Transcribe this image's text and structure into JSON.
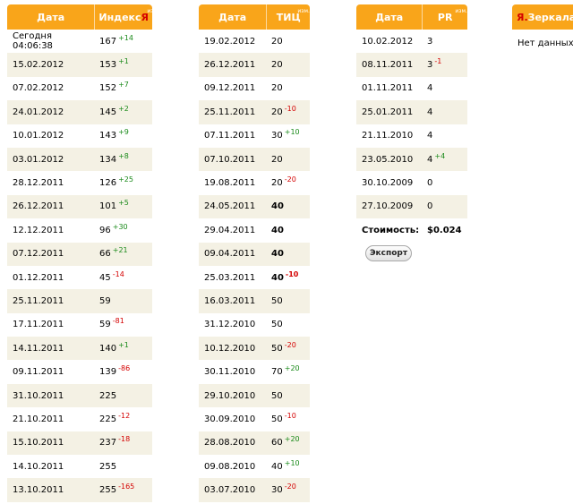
{
  "yandex_index": {
    "headers": {
      "date": "Дата",
      "value_prefix": "Индекс ",
      "value_ya": "Я",
      "change": "изм."
    },
    "rows": [
      {
        "date": "Сегодня 04:06:38",
        "value": "167",
        "delta": "+14",
        "dir": "up"
      },
      {
        "date": "15.02.2012",
        "value": "153",
        "delta": "+1",
        "dir": "up"
      },
      {
        "date": "07.02.2012",
        "value": "152",
        "delta": "+7",
        "dir": "up"
      },
      {
        "date": "24.01.2012",
        "value": "145",
        "delta": "+2",
        "dir": "up"
      },
      {
        "date": "10.01.2012",
        "value": "143",
        "delta": "+9",
        "dir": "up"
      },
      {
        "date": "03.01.2012",
        "value": "134",
        "delta": "+8",
        "dir": "up"
      },
      {
        "date": "28.12.2011",
        "value": "126",
        "delta": "+25",
        "dir": "up"
      },
      {
        "date": "26.12.2011",
        "value": "101",
        "delta": "+5",
        "dir": "up"
      },
      {
        "date": "12.12.2011",
        "value": "96",
        "delta": "+30",
        "dir": "up"
      },
      {
        "date": "07.12.2011",
        "value": "66",
        "delta": "+21",
        "dir": "up"
      },
      {
        "date": "01.12.2011",
        "value": "45",
        "delta": "-14",
        "dir": "down"
      },
      {
        "date": "25.11.2011",
        "value": "59",
        "delta": "",
        "dir": ""
      },
      {
        "date": "17.11.2011",
        "value": "59",
        "delta": "-81",
        "dir": "down"
      },
      {
        "date": "14.11.2011",
        "value": "140",
        "delta": "+1",
        "dir": "up"
      },
      {
        "date": "09.11.2011",
        "value": "139",
        "delta": "-86",
        "dir": "down"
      },
      {
        "date": "31.10.2011",
        "value": "225",
        "delta": "",
        "dir": ""
      },
      {
        "date": "21.10.2011",
        "value": "225",
        "delta": "-12",
        "dir": "down"
      },
      {
        "date": "15.10.2011",
        "value": "237",
        "delta": "-18",
        "dir": "down"
      },
      {
        "date": "14.10.2011",
        "value": "255",
        "delta": "",
        "dir": ""
      },
      {
        "date": "13.10.2011",
        "value": "255",
        "delta": "-165",
        "dir": "down"
      }
    ]
  },
  "tic": {
    "headers": {
      "date": "Дата",
      "value": "ТИЦ",
      "change": "изм."
    },
    "rows": [
      {
        "date": "19.02.2012",
        "value": "20",
        "delta": "",
        "dir": "",
        "bold": false
      },
      {
        "date": "26.12.2011",
        "value": "20",
        "delta": "",
        "dir": "",
        "bold": false
      },
      {
        "date": "09.12.2011",
        "value": "20",
        "delta": "",
        "dir": "",
        "bold": false
      },
      {
        "date": "25.11.2011",
        "value": "20",
        "delta": "-10",
        "dir": "down",
        "bold": false
      },
      {
        "date": "07.11.2011",
        "value": "30",
        "delta": "+10",
        "dir": "up",
        "bold": false
      },
      {
        "date": "07.10.2011",
        "value": "20",
        "delta": "",
        "dir": "",
        "bold": false
      },
      {
        "date": "19.08.2011",
        "value": "20",
        "delta": "-20",
        "dir": "down",
        "bold": false
      },
      {
        "date": "24.05.2011",
        "value": "40",
        "delta": "",
        "dir": "",
        "bold": true
      },
      {
        "date": "29.04.2011",
        "value": "40",
        "delta": "",
        "dir": "",
        "bold": true
      },
      {
        "date": "09.04.2011",
        "value": "40",
        "delta": "",
        "dir": "",
        "bold": true
      },
      {
        "date": "25.03.2011",
        "value": "40",
        "delta": "-10",
        "dir": "down",
        "bold": true
      },
      {
        "date": "16.03.2011",
        "value": "50",
        "delta": "",
        "dir": "",
        "bold": false
      },
      {
        "date": "31.12.2010",
        "value": "50",
        "delta": "",
        "dir": "",
        "bold": false
      },
      {
        "date": "10.12.2010",
        "value": "50",
        "delta": "-20",
        "dir": "down",
        "bold": false
      },
      {
        "date": "30.11.2010",
        "value": "70",
        "delta": "+20",
        "dir": "up",
        "bold": false
      },
      {
        "date": "29.10.2010",
        "value": "50",
        "delta": "",
        "dir": "",
        "bold": false
      },
      {
        "date": "30.09.2010",
        "value": "50",
        "delta": "-10",
        "dir": "down",
        "bold": false
      },
      {
        "date": "28.08.2010",
        "value": "60",
        "delta": "+20",
        "dir": "up",
        "bold": false
      },
      {
        "date": "09.08.2010",
        "value": "40",
        "delta": "+10",
        "dir": "up",
        "bold": false
      },
      {
        "date": "03.07.2010",
        "value": "30",
        "delta": "-20",
        "dir": "down",
        "bold": false
      }
    ]
  },
  "pagerank": {
    "headers": {
      "date": "Дата",
      "value": "PR",
      "change": "изм."
    },
    "rows": [
      {
        "date": "10.02.2012",
        "value": "3",
        "delta": "",
        "dir": ""
      },
      {
        "date": "08.11.2011",
        "value": "3",
        "delta": "-1",
        "dir": "down"
      },
      {
        "date": "01.11.2011",
        "value": "4",
        "delta": "",
        "dir": ""
      },
      {
        "date": "25.01.2011",
        "value": "4",
        "delta": "",
        "dir": ""
      },
      {
        "date": "21.11.2010",
        "value": "4",
        "delta": "",
        "dir": ""
      },
      {
        "date": "23.05.2010",
        "value": "4",
        "delta": "+4",
        "dir": "up"
      },
      {
        "date": "30.10.2009",
        "value": "0",
        "delta": "",
        "dir": ""
      },
      {
        "date": "27.10.2009",
        "value": "0",
        "delta": "",
        "dir": ""
      }
    ],
    "cost_label": "Стоимость:",
    "cost_value": "$0.024",
    "export_label": "Экспорт"
  },
  "mirrors": {
    "header_ya": "Я.",
    "header_rest": "Зеркала",
    "empty_text": "Нет данных"
  },
  "colors": {
    "header_bg": "#f9a51a",
    "stripe": "#f4f1e4",
    "up": "#1a8a1a",
    "down": "#d40000"
  }
}
